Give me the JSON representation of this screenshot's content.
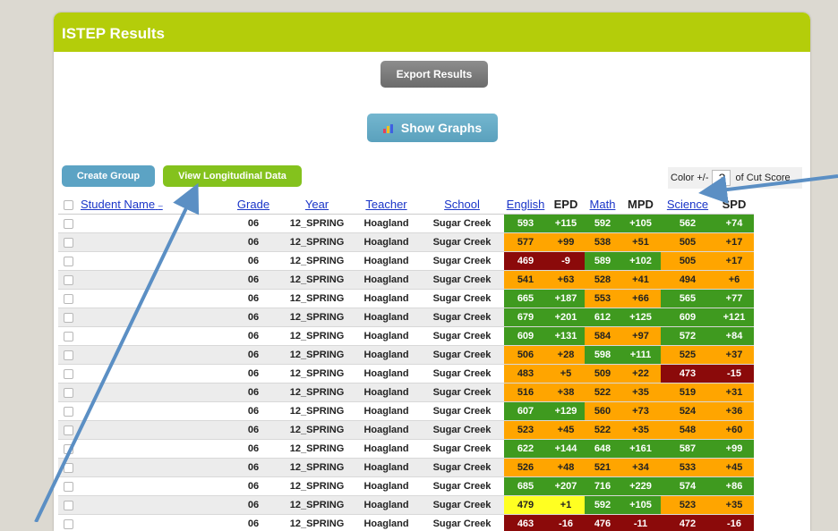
{
  "panel": {
    "title": "ISTEP Results"
  },
  "buttons": {
    "export": "Export Results",
    "graphs": "Show Graphs",
    "create_group": "Create Group",
    "longitudinal": "View Longitudinal Data"
  },
  "color_control": {
    "label_before": "Color +/-",
    "value": "3",
    "label_after": "of Cut Score"
  },
  "columns": {
    "name": "Student Name",
    "sort_indicator": "–",
    "grade": "Grade",
    "year": "Year",
    "teacher": "Teacher",
    "school": "School",
    "english": "English",
    "epd": "EPD",
    "math": "Math",
    "mpd": "MPD",
    "science": "Science",
    "spd": "SPD"
  },
  "colors": {
    "green": "#3f9a1f",
    "orange": "#ffa500",
    "red": "#8b0a0a",
    "yellow": "#ffff22",
    "link": "#1a35c8",
    "header_bar": "#b4cd0a",
    "arrow": "#5b8fc4"
  },
  "icons": {
    "graph": "bar-chart-icon",
    "checkbox": "checkbox-icon"
  },
  "rows": [
    {
      "grade": "06",
      "year": "12_SPRING",
      "teacher": "Hoagland",
      "school": "Sugar Creek",
      "english": "593",
      "epd": "+115",
      "math": "592",
      "mpd": "+105",
      "science": "562",
      "spd": "+74",
      "e_color": "green",
      "m_color": "green",
      "s_color": "green"
    },
    {
      "grade": "06",
      "year": "12_SPRING",
      "teacher": "Hoagland",
      "school": "Sugar Creek",
      "english": "577",
      "epd": "+99",
      "math": "538",
      "mpd": "+51",
      "science": "505",
      "spd": "+17",
      "e_color": "orange",
      "m_color": "orange",
      "s_color": "orange"
    },
    {
      "grade": "06",
      "year": "12_SPRING",
      "teacher": "Hoagland",
      "school": "Sugar Creek",
      "english": "469",
      "epd": "-9",
      "math": "589",
      "mpd": "+102",
      "science": "505",
      "spd": "+17",
      "e_color": "red",
      "m_color": "green",
      "s_color": "orange"
    },
    {
      "grade": "06",
      "year": "12_SPRING",
      "teacher": "Hoagland",
      "school": "Sugar Creek",
      "english": "541",
      "epd": "+63",
      "math": "528",
      "mpd": "+41",
      "science": "494",
      "spd": "+6",
      "e_color": "orange",
      "m_color": "orange",
      "s_color": "orange"
    },
    {
      "grade": "06",
      "year": "12_SPRING",
      "teacher": "Hoagland",
      "school": "Sugar Creek",
      "english": "665",
      "epd": "+187",
      "math": "553",
      "mpd": "+66",
      "science": "565",
      "spd": "+77",
      "e_color": "green",
      "m_color": "orange",
      "s_color": "green"
    },
    {
      "grade": "06",
      "year": "12_SPRING",
      "teacher": "Hoagland",
      "school": "Sugar Creek",
      "english": "679",
      "epd": "+201",
      "math": "612",
      "mpd": "+125",
      "science": "609",
      "spd": "+121",
      "e_color": "green",
      "m_color": "green",
      "s_color": "green"
    },
    {
      "grade": "06",
      "year": "12_SPRING",
      "teacher": "Hoagland",
      "school": "Sugar Creek",
      "english": "609",
      "epd": "+131",
      "math": "584",
      "mpd": "+97",
      "science": "572",
      "spd": "+84",
      "e_color": "green",
      "m_color": "orange",
      "s_color": "green"
    },
    {
      "grade": "06",
      "year": "12_SPRING",
      "teacher": "Hoagland",
      "school": "Sugar Creek",
      "english": "506",
      "epd": "+28",
      "math": "598",
      "mpd": "+111",
      "science": "525",
      "spd": "+37",
      "e_color": "orange",
      "m_color": "green",
      "s_color": "orange"
    },
    {
      "grade": "06",
      "year": "12_SPRING",
      "teacher": "Hoagland",
      "school": "Sugar Creek",
      "english": "483",
      "epd": "+5",
      "math": "509",
      "mpd": "+22",
      "science": "473",
      "spd": "-15",
      "e_color": "orange",
      "m_color": "orange",
      "s_color": "red"
    },
    {
      "grade": "06",
      "year": "12_SPRING",
      "teacher": "Hoagland",
      "school": "Sugar Creek",
      "english": "516",
      "epd": "+38",
      "math": "522",
      "mpd": "+35",
      "science": "519",
      "spd": "+31",
      "e_color": "orange",
      "m_color": "orange",
      "s_color": "orange"
    },
    {
      "grade": "06",
      "year": "12_SPRING",
      "teacher": "Hoagland",
      "school": "Sugar Creek",
      "english": "607",
      "epd": "+129",
      "math": "560",
      "mpd": "+73",
      "science": "524",
      "spd": "+36",
      "e_color": "green",
      "m_color": "orange",
      "s_color": "orange"
    },
    {
      "grade": "06",
      "year": "12_SPRING",
      "teacher": "Hoagland",
      "school": "Sugar Creek",
      "english": "523",
      "epd": "+45",
      "math": "522",
      "mpd": "+35",
      "science": "548",
      "spd": "+60",
      "e_color": "orange",
      "m_color": "orange",
      "s_color": "orange"
    },
    {
      "grade": "06",
      "year": "12_SPRING",
      "teacher": "Hoagland",
      "school": "Sugar Creek",
      "english": "622",
      "epd": "+144",
      "math": "648",
      "mpd": "+161",
      "science": "587",
      "spd": "+99",
      "e_color": "green",
      "m_color": "green",
      "s_color": "green"
    },
    {
      "grade": "06",
      "year": "12_SPRING",
      "teacher": "Hoagland",
      "school": "Sugar Creek",
      "english": "526",
      "epd": "+48",
      "math": "521",
      "mpd": "+34",
      "science": "533",
      "spd": "+45",
      "e_color": "orange",
      "m_color": "orange",
      "s_color": "orange"
    },
    {
      "grade": "06",
      "year": "12_SPRING",
      "teacher": "Hoagland",
      "school": "Sugar Creek",
      "english": "685",
      "epd": "+207",
      "math": "716",
      "mpd": "+229",
      "science": "574",
      "spd": "+86",
      "e_color": "green",
      "m_color": "green",
      "s_color": "green"
    },
    {
      "grade": "06",
      "year": "12_SPRING",
      "teacher": "Hoagland",
      "school": "Sugar Creek",
      "english": "479",
      "epd": "+1",
      "math": "592",
      "mpd": "+105",
      "science": "523",
      "spd": "+35",
      "e_color": "yellow",
      "m_color": "green",
      "s_color": "orange"
    },
    {
      "grade": "06",
      "year": "12_SPRING",
      "teacher": "Hoagland",
      "school": "Sugar Creek",
      "english": "463",
      "epd": "-16",
      "math": "476",
      "mpd": "-11",
      "science": "472",
      "spd": "-16",
      "e_color": "red",
      "m_color": "red",
      "s_color": "red"
    }
  ]
}
